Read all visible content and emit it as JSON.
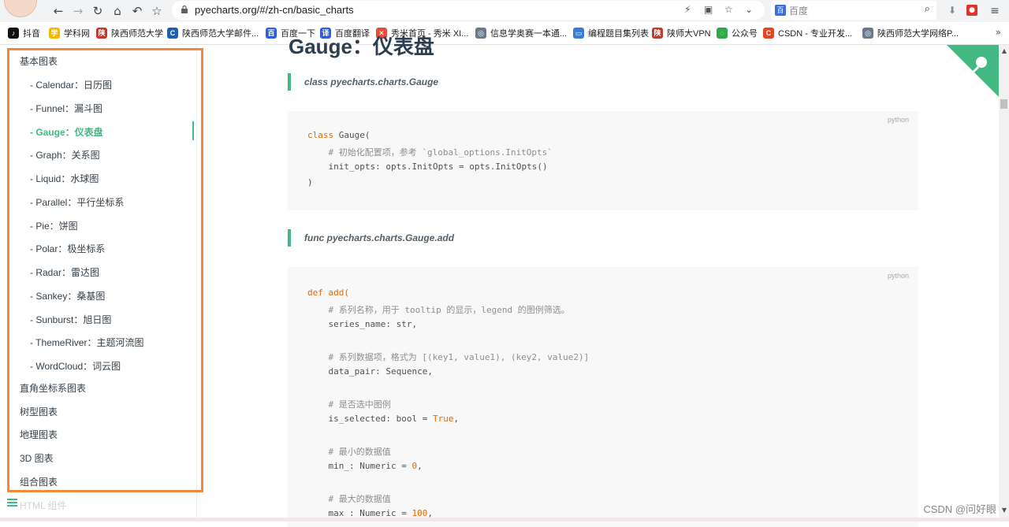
{
  "browser": {
    "url": "pyecharts.org/#/zh-cn/basic_charts",
    "search_placeholder": "百度",
    "search_engine_icon": "baidu-icon",
    "nav_icons": [
      "back-icon",
      "forward-icon",
      "reload-icon",
      "home-icon",
      "undo-icon",
      "star-icon"
    ]
  },
  "bookmarks": [
    {
      "label": "抖音",
      "color": "#111111",
      "glyph": "♪"
    },
    {
      "label": "学科网",
      "color": "#f5b800",
      "glyph": "学"
    },
    {
      "label": "陕西师范大学",
      "color": "#c0392b",
      "glyph": "陕"
    },
    {
      "label": "陕西师范大学邮件...",
      "color": "#1a5fb4",
      "glyph": "C"
    },
    {
      "label": "百度一下",
      "color": "#2e5ee0",
      "glyph": "百"
    },
    {
      "label": "百度翻译",
      "color": "#2e5ee0",
      "glyph": "译"
    },
    {
      "label": "秀米首页 - 秀米 XI...",
      "color": "#e84c3d",
      "glyph": "✕"
    },
    {
      "label": "信息学奥赛一本通...",
      "color": "#6b7b8c",
      "glyph": "◎"
    },
    {
      "label": "编程题目集列表",
      "color": "#3a7bd5",
      "glyph": "▭"
    },
    {
      "label": "陕师大VPN",
      "color": "#c0392b",
      "glyph": "陕"
    },
    {
      "label": "公众号",
      "color": "#2eaa4a",
      "glyph": "◌"
    },
    {
      "label": "CSDN - 专业开发...",
      "color": "#e8441f",
      "glyph": "C"
    },
    {
      "label": "陕西师范大学网络P...",
      "color": "#6b7b8c",
      "glyph": "◎"
    }
  ],
  "sidebar": {
    "section_basic": "基本图表",
    "items": [
      {
        "label": "- Calendar：日历图",
        "active": false
      },
      {
        "label": "- Funnel：漏斗图",
        "active": false
      },
      {
        "label": "- Gauge：仪表盘",
        "active": true
      },
      {
        "label": "- Graph：关系图",
        "active": false
      },
      {
        "label": "- Liquid：水球图",
        "active": false
      },
      {
        "label": "- Parallel：平行坐标系",
        "active": false
      },
      {
        "label": "- Pie：饼图",
        "active": false
      },
      {
        "label": "- Polar：极坐标系",
        "active": false
      },
      {
        "label": "- Radar：雷达图",
        "active": false
      },
      {
        "label": "- Sankey：桑基图",
        "active": false
      },
      {
        "label": "- Sunburst：旭日图",
        "active": false
      },
      {
        "label": "- ThemeRiver：主题河流图",
        "active": false
      },
      {
        "label": "- WordCloud：词云图",
        "active": false
      }
    ],
    "sections": [
      "直角坐标系图表",
      "树型图表",
      "地理图表",
      "3D 图表",
      "组合图表"
    ],
    "html_components": "HTML 组件"
  },
  "main": {
    "partial_title": "Gauge：仪表盘",
    "tip1": "class pyecharts.charts.Gauge",
    "tip2": "func pyecharts.charts.Gauge.add",
    "code_lang": "python",
    "block1": {
      "l1_kw": "class",
      "l1_rest": " Gauge(",
      "l2": "    # 初始化配置项，参考 `global_options.InitOpts`",
      "l3": "    init_opts: opts.InitOpts = opts.InitOpts()",
      "l4": ")"
    },
    "block2": {
      "l1_kw": "def",
      "l1_fn": " add(",
      "l2": "    # 系列名称，用于 tooltip 的显示，legend 的图例筛选。",
      "l3": "    series_name: str,",
      "l5": "    # 系列数据项，格式为 [(key1, value1), (key2, value2)]",
      "l6": "    data_pair: Sequence,",
      "l8": "    # 是否选中图例",
      "l9_a": "    is_selected: bool = ",
      "l9_b": "True",
      "l9_c": ",",
      "l11": "    # 最小的数据值",
      "l12_a": "    min_: Numeric = ",
      "l12_b": "0",
      "l12_c": ",",
      "l14": "    # 最大的数据值",
      "l15_a": "    max_: Numeric = ",
      "l15_b": "100",
      "l15_c": ","
    }
  },
  "watermark": "CSDN @问好眼",
  "colors": {
    "accent": "#42b983",
    "highlight_box": "#f0883e"
  }
}
